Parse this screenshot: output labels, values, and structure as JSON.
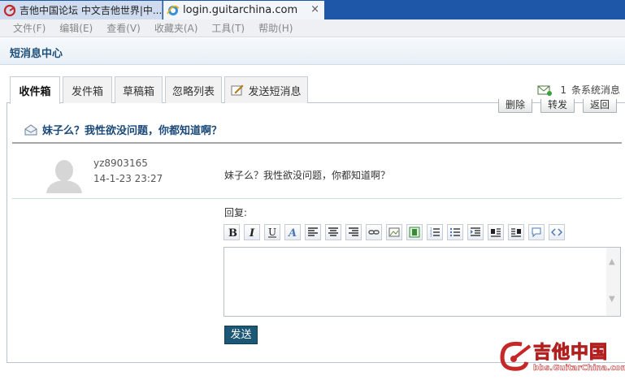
{
  "browser_tabs": [
    {
      "title": "吉他中国论坛 中文吉他世界|中..."
    },
    {
      "title": "login.guitarchina.com",
      "close": "×"
    }
  ],
  "menubar": [
    "文件(F)",
    "编辑(E)",
    "查看(V)",
    "收藏夹(A)",
    "工具(T)",
    "帮助(H)"
  ],
  "page": {
    "title": "短消息中心"
  },
  "tabs": [
    {
      "label": "收件箱",
      "active": true
    },
    {
      "label": "发件箱"
    },
    {
      "label": "草稿箱"
    },
    {
      "label": "忽略列表"
    },
    {
      "label": "发送短消息"
    }
  ],
  "system_msg": {
    "count": "1",
    "label": "条系统消息"
  },
  "actions": {
    "delete": "删除",
    "forward": "转发",
    "back": "返回"
  },
  "message": {
    "subject": "妹子么？我性欲没问题，你都知道啊？",
    "sender": "yz8903165",
    "time": "14-1-23 23:27",
    "body": "妹子么？我性欲没问题，你都知道啊？"
  },
  "reply": {
    "label": "回复:",
    "toolbar": [
      "bold",
      "italic",
      "underline",
      "font-color",
      "align-left",
      "align-center",
      "align-right",
      "link",
      "image",
      "attachment",
      "ordered-list",
      "unordered-list",
      "indent",
      "float-left",
      "float-right",
      "quote",
      "code"
    ],
    "send_label": "发送"
  },
  "watermark": {
    "text": "吉他中国",
    "url": "bbs.GuitarChina.com"
  },
  "colors": {
    "tab_strip": "#1f57a8",
    "send_button": "#1c5876",
    "subject": "#1b4a79"
  }
}
